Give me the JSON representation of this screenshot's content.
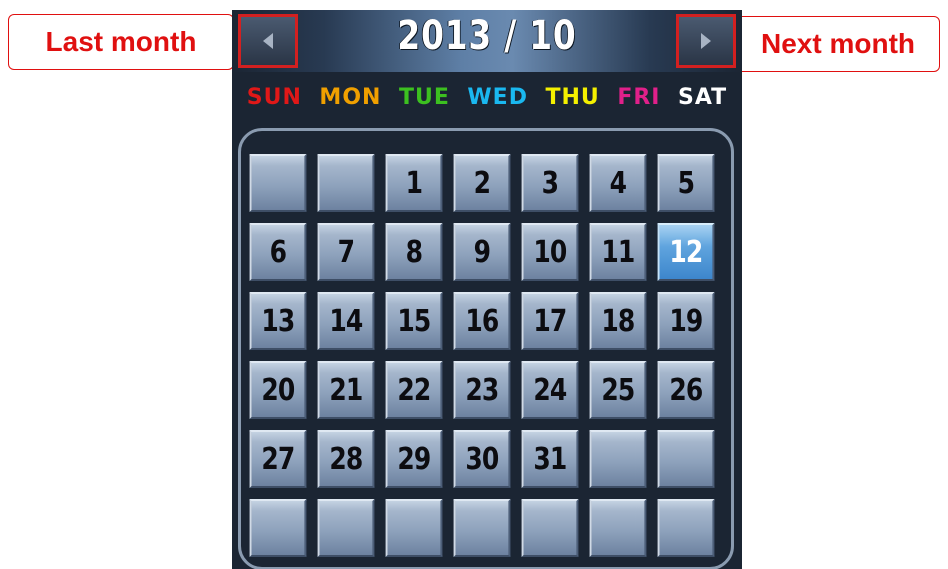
{
  "calendar": {
    "title": "2013 / 10",
    "weekdays": [
      {
        "label": "SUN",
        "color": "#e01818"
      },
      {
        "label": "MON",
        "color": "#f0a000"
      },
      {
        "label": "TUE",
        "color": "#3cc020"
      },
      {
        "label": "WED",
        "color": "#1ab8f0"
      },
      {
        "label": "THU",
        "color": "#f4f000"
      },
      {
        "label": "FRI",
        "color": "#e0208a"
      },
      {
        "label": "SAT",
        "color": "#ffffff"
      }
    ],
    "days": [
      "",
      "",
      "1",
      "2",
      "3",
      "4",
      "5",
      "6",
      "7",
      "8",
      "9",
      "10",
      "11",
      "12",
      "13",
      "14",
      "15",
      "16",
      "17",
      "18",
      "19",
      "20",
      "21",
      "22",
      "23",
      "24",
      "25",
      "26",
      "27",
      "28",
      "29",
      "30",
      "31",
      "",
      "",
      "",
      "",
      "",
      "",
      "",
      "",
      ""
    ],
    "selected_day": "12",
    "prev_icon": "chevron-left-icon",
    "next_icon": "chevron-right-icon"
  },
  "callouts": {
    "last_month": "Last month",
    "next_month": "Next month",
    "color": "#e01010"
  }
}
